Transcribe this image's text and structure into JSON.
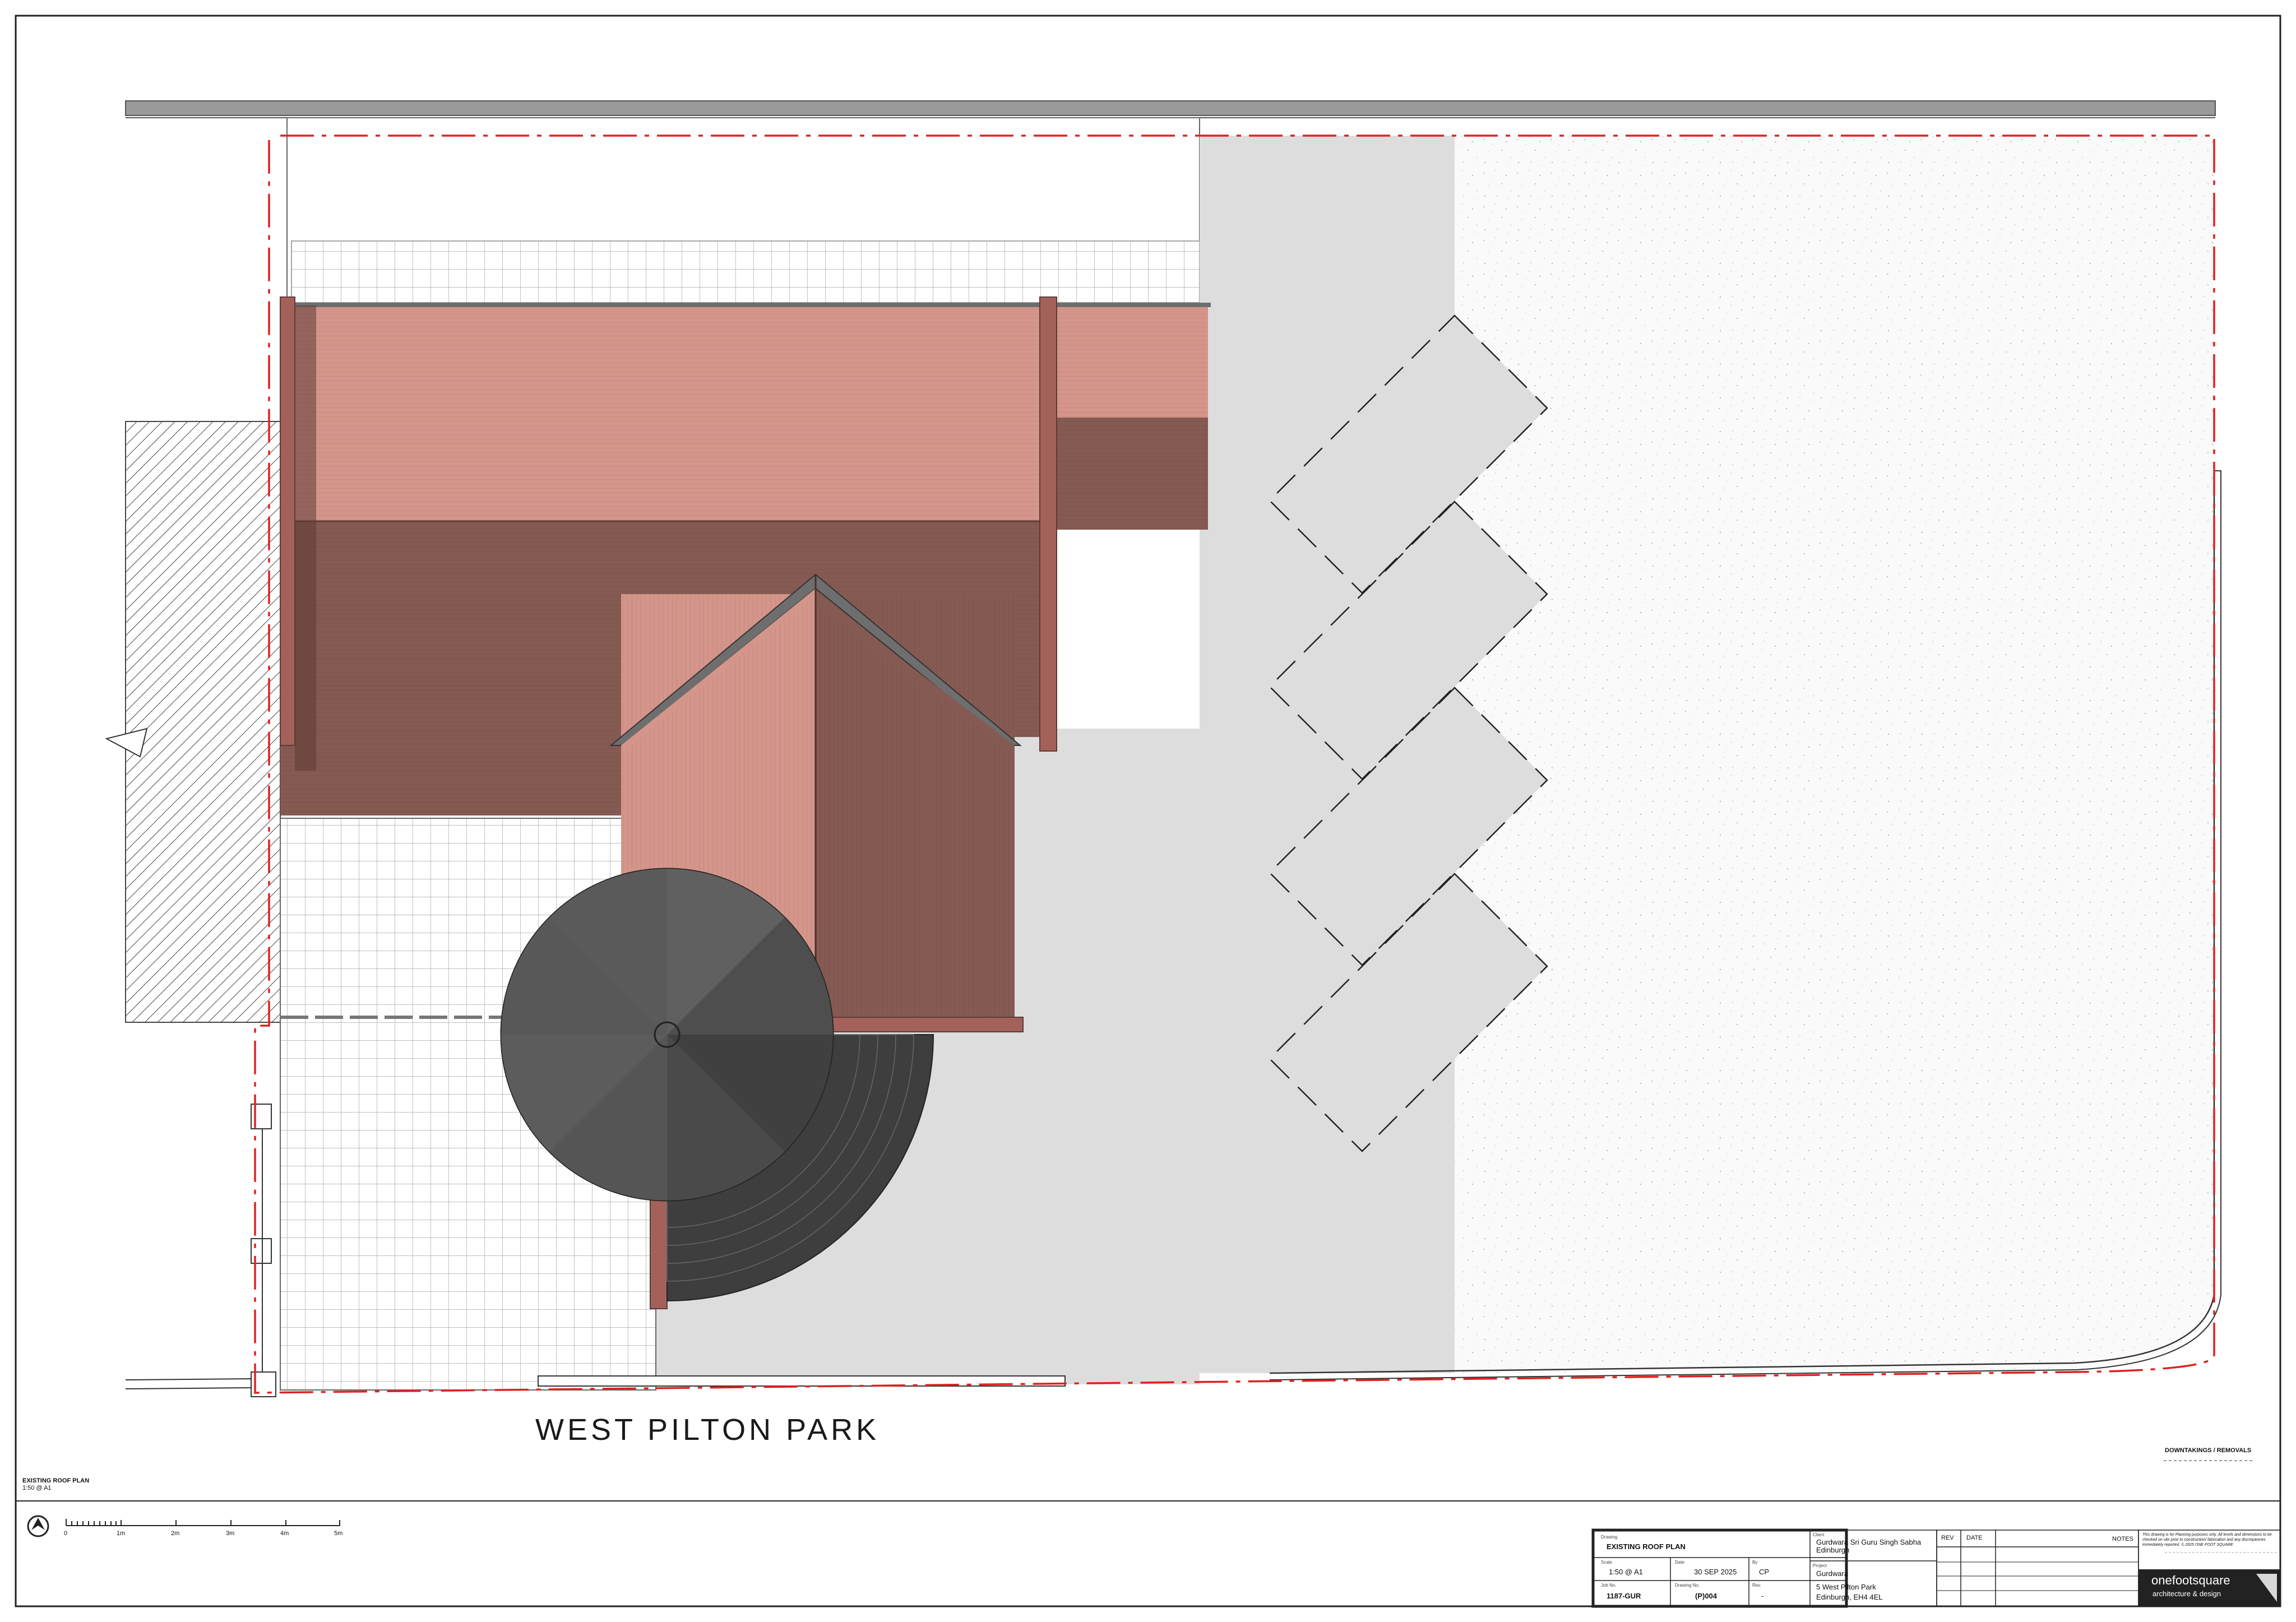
{
  "street_name": "WEST PILTON PARK",
  "view": {
    "title": "EXISTING ROOF PLAN",
    "scale": "1:50 @ A1"
  },
  "legend": {
    "downtakings": "DOWNTAKINGS / REMOVALS"
  },
  "scale_bar": {
    "labels": [
      "0",
      "1m",
      "2m",
      "3m",
      "4m",
      "5m"
    ]
  },
  "title_block": {
    "drawing_label": "Drawing",
    "drawing": "EXISTING ROOF PLAN",
    "scale_label": "Scale",
    "scale": "1:50 @ A1",
    "date_label": "Date",
    "date": "30 SEP 2025",
    "by_label": "By",
    "by": "CP",
    "job_label": "Job No.",
    "job": "1187-GUR",
    "drawing_no_label": "Drawing No.",
    "drawing_no": "(P)004",
    "rev_label": "Rev.",
    "rev": "-",
    "client_label": "Client",
    "client_line1": "Gurdwara Sri Guru Singh Sabha",
    "client_line2": "Edinburgh",
    "project_label": "Project",
    "project_line1": "Gurdwara",
    "project_line2": "5 West Pilton Park",
    "project_line3": "Edinburgh, EH4 4EL",
    "rev_header": "REV",
    "date_header": "DATE",
    "notes_header": "NOTES",
    "disclaimer": "This drawing is for Planning purposes only. All levels and dimensions to be checked on site prior to construction/ fabrication and any discrepancies immediately reported. © 2025 ONE FOOT SQUARE",
    "logo_word": "onefootsquare",
    "logo_sub": "architecture & design"
  },
  "colors": {
    "roof_light": "#d4958a",
    "roof_dark": "#855a52",
    "roof_ridge": "#6e6e6e",
    "turret": "#555555",
    "driveway": "#dddddd",
    "boundary": "#e02020"
  }
}
